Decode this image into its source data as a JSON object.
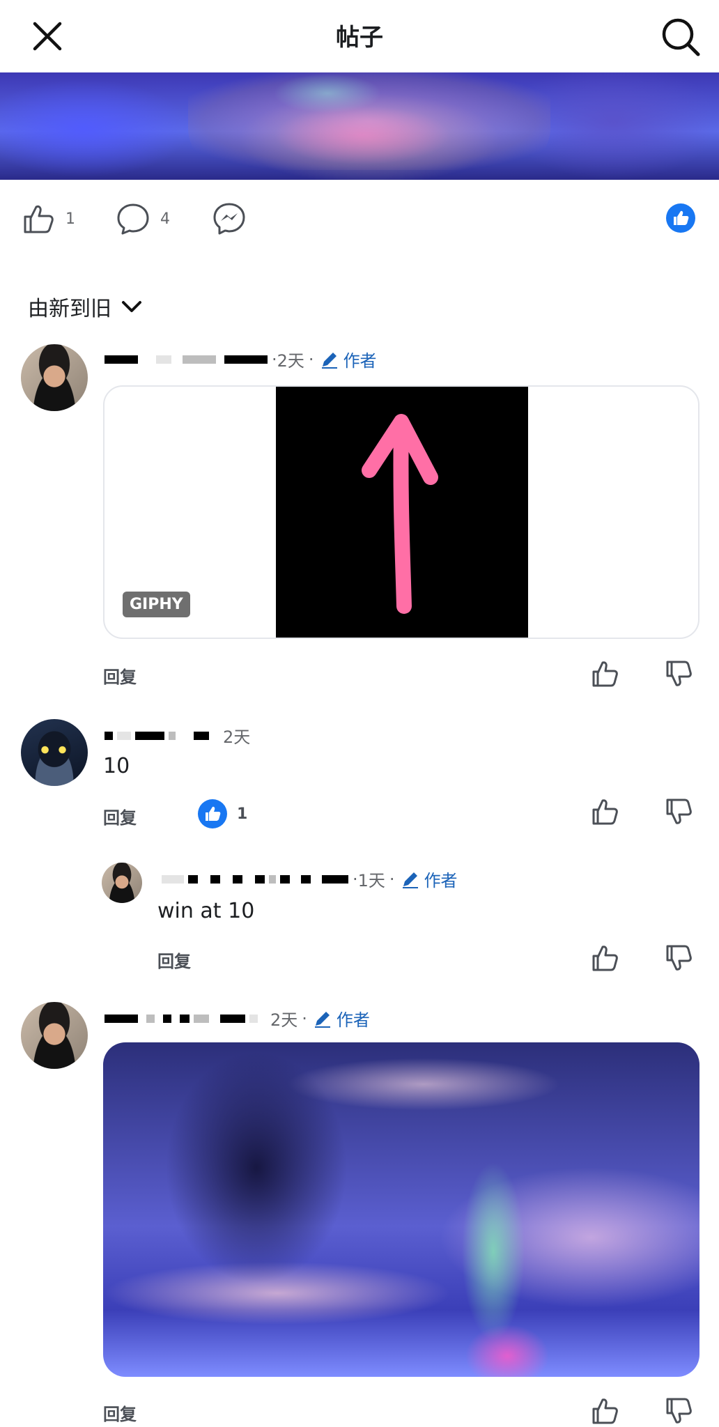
{
  "header": {
    "title": "帖子",
    "close_icon": "close-icon",
    "search_icon": "search-icon"
  },
  "actions": {
    "like_count": "1",
    "comment_count": "4",
    "messenger_icon": "messenger-icon",
    "reaction_badge_icon": "like-reaction-icon"
  },
  "sort": {
    "label": "由新到旧"
  },
  "comments": [
    {
      "time": "2天",
      "author_badge": "作者",
      "attachment": {
        "type": "gif",
        "provider": "GIPHY"
      },
      "reply_label": "回复"
    },
    {
      "time": "2天",
      "text": "10",
      "reply_label": "回复",
      "reaction_count": "1",
      "replies": [
        {
          "time": "1天",
          "author_badge": "作者",
          "text": "win at 10",
          "reply_label": "回复"
        }
      ]
    },
    {
      "time": "2天",
      "author_badge": "作者",
      "attachment": {
        "type": "photo"
      },
      "reply_label": "回复"
    }
  ],
  "colors": {
    "accent": "#1b63b8",
    "reaction_blue": "#1877f2",
    "gif_arrow": "#ff6fa6"
  }
}
